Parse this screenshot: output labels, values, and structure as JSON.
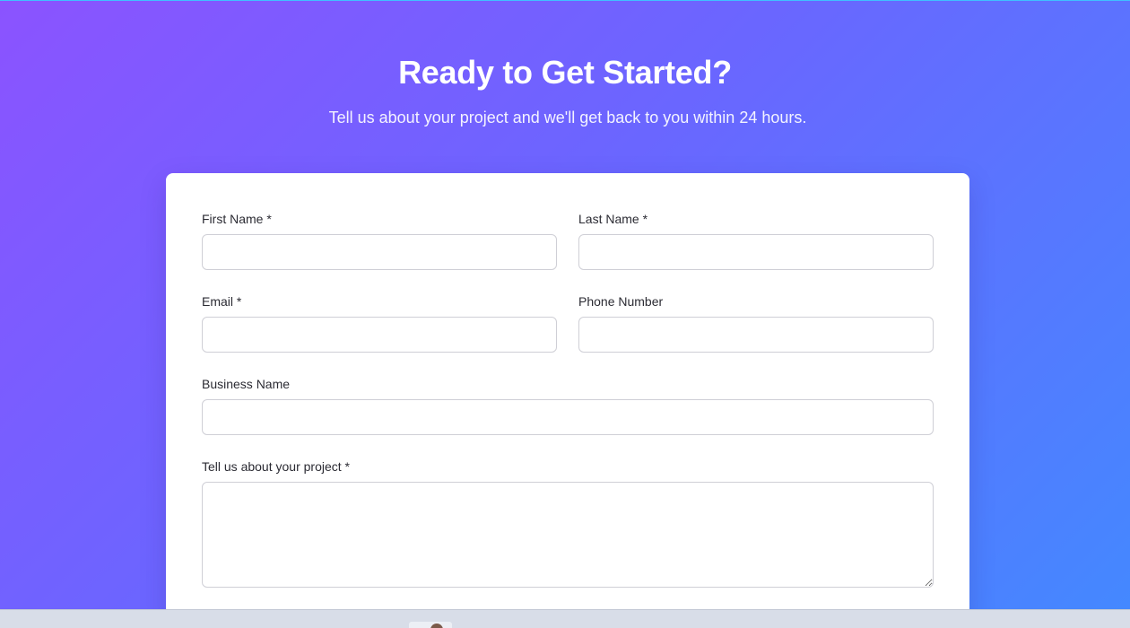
{
  "hero": {
    "title": "Ready to Get Started?",
    "subtitle": "Tell us about your project and we'll get back to you within 24 hours."
  },
  "form": {
    "first_name": {
      "label": "First Name *",
      "value": "",
      "placeholder": ""
    },
    "last_name": {
      "label": "Last Name *",
      "value": "",
      "placeholder": ""
    },
    "email": {
      "label": "Email *",
      "value": "",
      "placeholder": ""
    },
    "phone": {
      "label": "Phone Number",
      "value": "",
      "placeholder": ""
    },
    "business_name": {
      "label": "Business Name",
      "value": "",
      "placeholder": ""
    },
    "project": {
      "label": "Tell us about your project *",
      "value": "",
      "placeholder": ""
    }
  },
  "colors": {
    "gradient_start": "#8b53ff",
    "gradient_end": "#4488ff",
    "card_background": "#ffffff",
    "input_border": "#cfcfd6"
  },
  "taskbar": {
    "pinned_icon": "user-avatar-icon"
  }
}
